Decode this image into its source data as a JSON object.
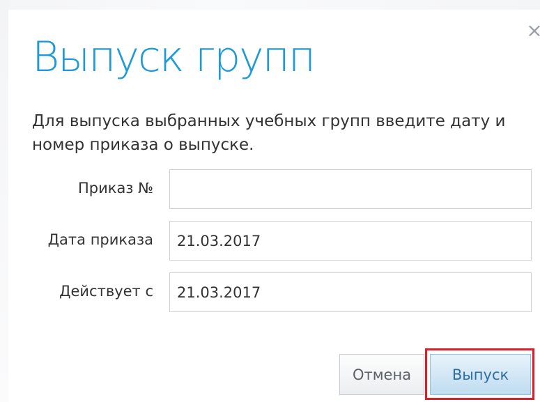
{
  "dialog": {
    "title": "Выпуск групп",
    "close_glyph": "×",
    "description": "Для выпуска выбранных учебных групп введите дату и номер приказа о выпуске.",
    "fields": [
      {
        "label": "Приказ №",
        "value": ""
      },
      {
        "label": "Дата приказа",
        "value": "21.03.2017"
      },
      {
        "label": "Действует с",
        "value": "21.03.2017"
      }
    ],
    "buttons": {
      "cancel": "Отмена",
      "submit": "Выпуск"
    }
  },
  "colors": {
    "title": "#1e9ad6",
    "highlight_border": "#d9202a",
    "primary_button": "#bfdcf0"
  },
  "icons": {
    "close": "close-icon"
  }
}
